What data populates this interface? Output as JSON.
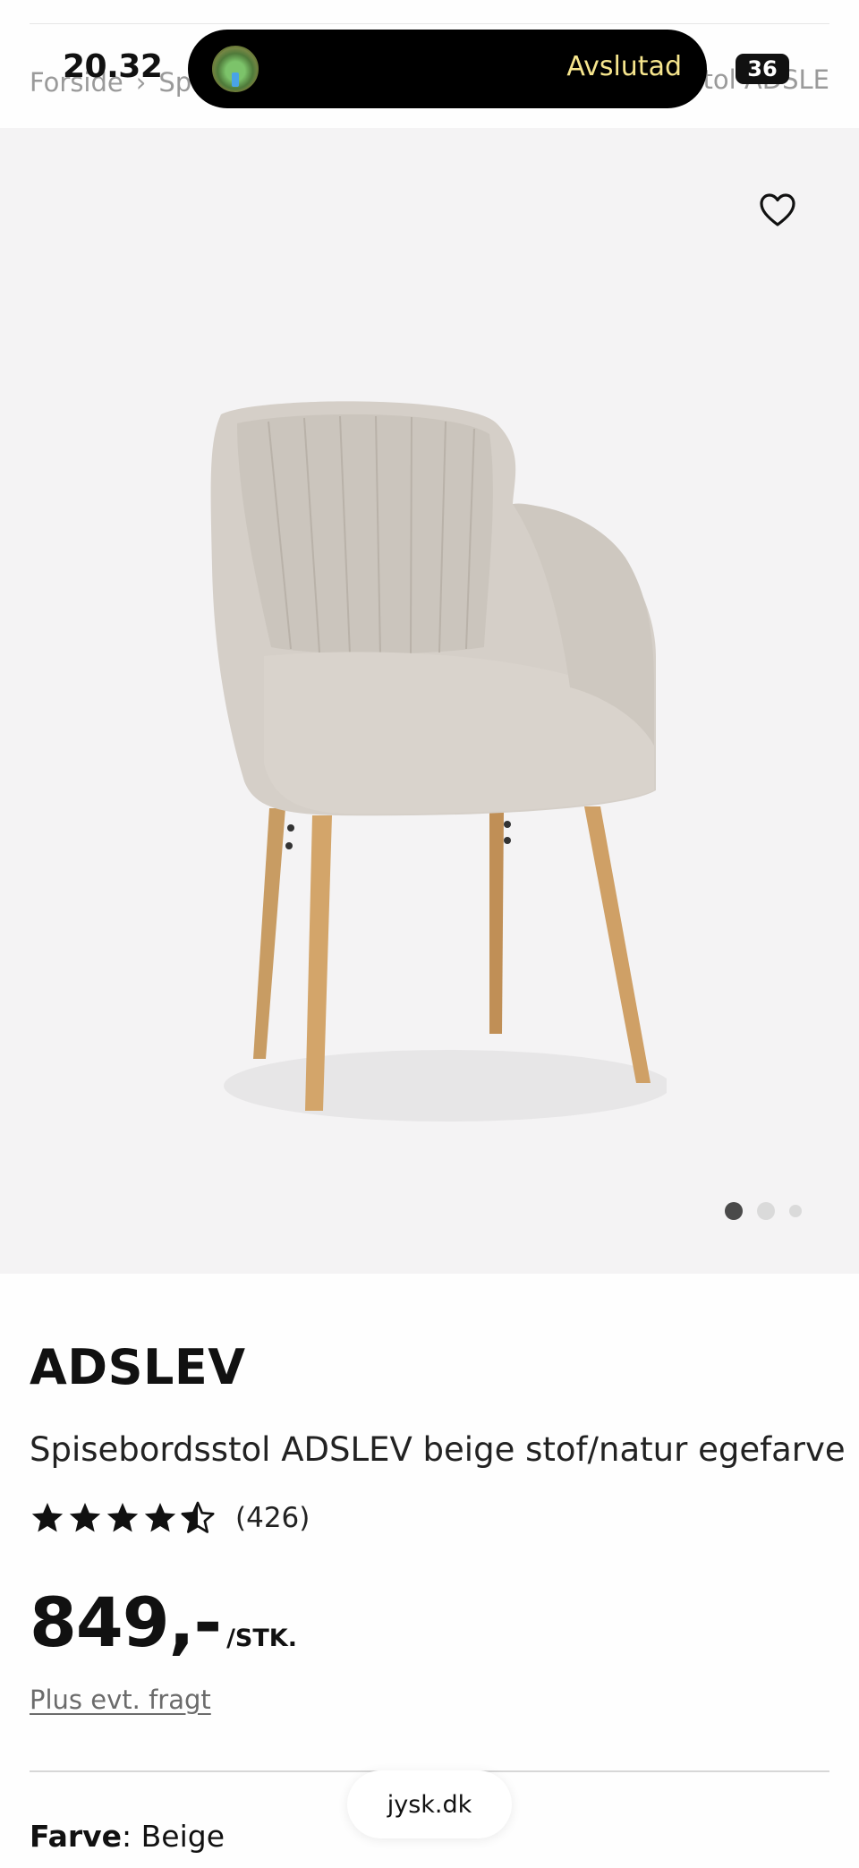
{
  "status_bar": {
    "time": "20.32",
    "activity_status": "Avslutad",
    "badge_count": "36"
  },
  "breadcrumb": {
    "items": [
      "Forside",
      "Sp"
    ],
    "tail": "sstol ADSLE"
  },
  "product": {
    "brand": "ADSLEV",
    "title": "Spisebordsstol ADSLEV beige stof/natur egefarve",
    "rating_value": 4.5,
    "rating_count": "(426)",
    "price": "849,-",
    "price_unit": "/STK.",
    "shipping_note": "Plus evt. fragt",
    "color_label": "Farve",
    "color_separator": ":",
    "color_value": " Beige"
  },
  "gallery": {
    "image_count": 3,
    "active_index": 0
  },
  "browser": {
    "url": "jysk.dk"
  },
  "colors": {
    "image_bg": "#f4f3f4",
    "island_text": "#f6e58d",
    "active_dot": "#4a4a4a"
  },
  "icons": {
    "favorite": "heart-outline-icon",
    "breadcrumb_separator": "chevron-right-icon",
    "rating": "star-icon"
  }
}
